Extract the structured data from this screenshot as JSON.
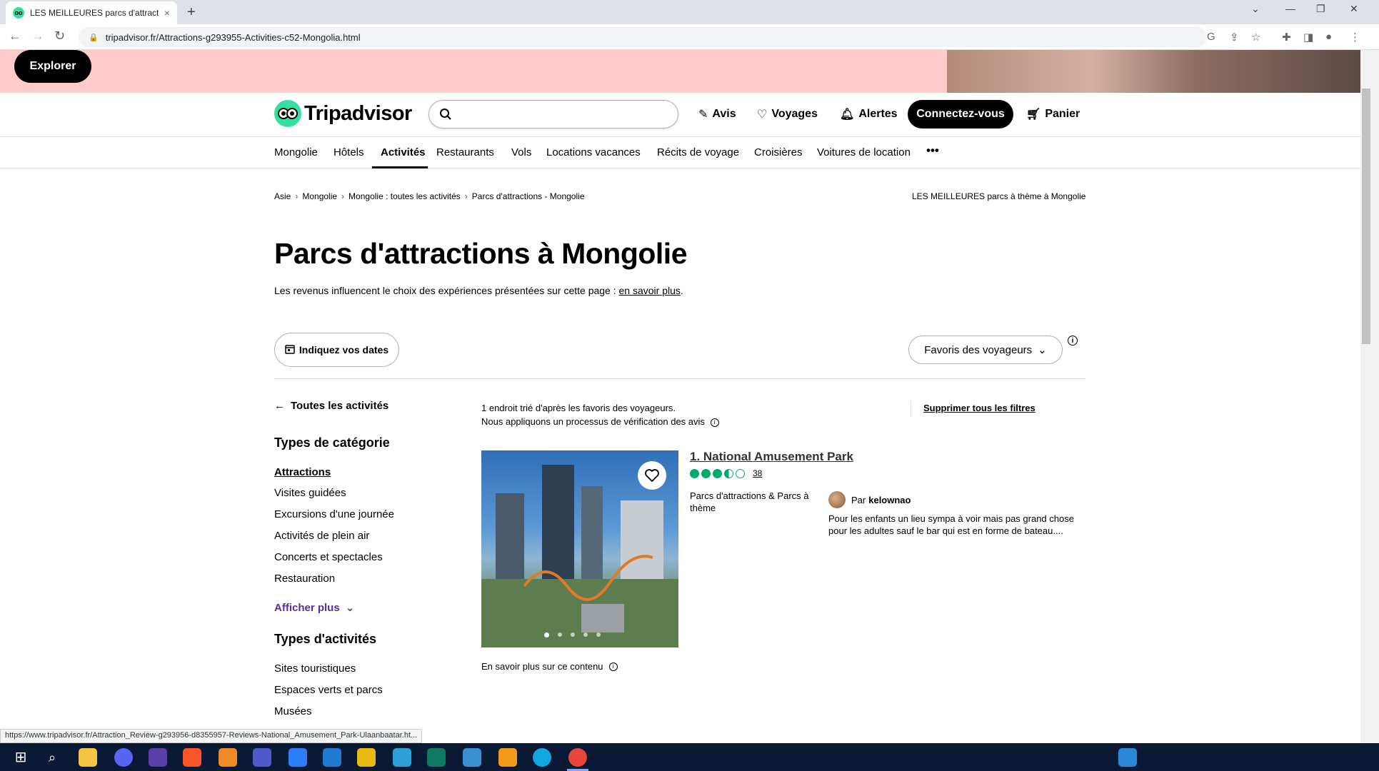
{
  "browser": {
    "tab_title": "LES MEILLEURES parcs d'attractio",
    "tab_close": "×",
    "new_tab": "+",
    "url": "tripadvisor.fr/Attractions-g293955-Activities-c52-Mongolia.html",
    "status_url": "https://www.tripadvisor.fr/Attraction_Review-g293956-d8355957-Reviews-National_Amusement_Park-Ulaanbaatar.ht..."
  },
  "banner": {
    "explore_label": "Explorer"
  },
  "header": {
    "logo": "Tripadvisor",
    "search_placeholder": "",
    "links": {
      "reviews": "Avis",
      "trips": "Voyages",
      "alerts": "Alertes",
      "cart": "Panier"
    },
    "connect_label": "Connectez-vous"
  },
  "subnav": {
    "items": [
      "Mongolie",
      "Hôtels",
      "Activités",
      "Restaurants",
      "Vols",
      "Locations vacances",
      "Récits de voyage",
      "Croisières",
      "Voitures de location"
    ],
    "more": "•••"
  },
  "breadcrumb": {
    "items": [
      "Asie",
      "Mongolie",
      "Mongolie : toutes les activités",
      "Parcs d'attractions - Mongolie"
    ],
    "separator": "›",
    "right": "LES MEILLEURES parcs à thème à Mongolie"
  },
  "page": {
    "title": "Parcs d'attractions à Mongolie",
    "disclaimer": "Les revenus influencent le choix des expériences présentées sur cette page :",
    "disclaimer_link": "en savoir plus",
    "disclaimer_end": ".",
    "dates_button": "Indiquez vos dates",
    "sort_button": "Favoris des voyageurs",
    "info": "i"
  },
  "sidebar": {
    "back": "Toutes les activités",
    "category_heading": "Types de catégorie",
    "categories": [
      "Attractions",
      "Visites guidées",
      "Excursions d'une journée",
      "Activités de plein air",
      "Concerts et spectacles",
      "Restauration"
    ],
    "show_more": "Afficher plus",
    "activity_heading": "Types d'activités",
    "activities": [
      "Sites touristiques",
      "Espaces verts et parcs",
      "Musées"
    ]
  },
  "results": {
    "meta_line1": "1 endroit trié d'après les favoris des voyageurs.",
    "meta_line2": "Nous appliquons un processus de vérification des avis",
    "clear_filters": "Supprimer tous les filtres",
    "more_content": "En savoir plus sur ce contenu",
    "card": {
      "title": "1. National Amusement Park",
      "rating": 3.5,
      "review_count": "38",
      "category": "Parcs d'attractions & Parcs à thème",
      "reviewer_prefix": "Par",
      "reviewer": "kelownao",
      "snippet": "Pour les enfants un lieu sympa à voir mais pas grand chose pour les adultes sauf le bar qui est en forme de bateau....",
      "image_count": 5,
      "image_index": 1
    }
  },
  "colors": {
    "brand": "#34e0a1",
    "bubble": "#00aa6c",
    "banner": "#ffcbcb",
    "link_purple": "#5b2d9b"
  }
}
